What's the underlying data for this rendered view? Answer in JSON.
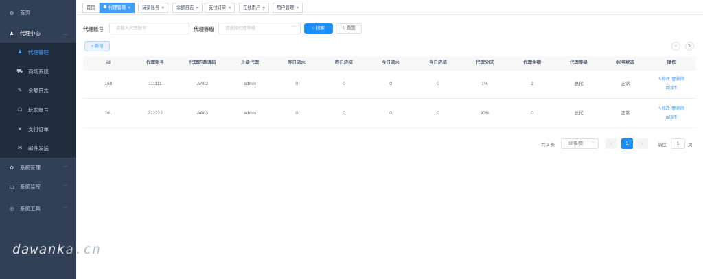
{
  "sidebar": {
    "items": [
      {
        "label": "首页",
        "icon": "dashboard-icon"
      },
      {
        "label": "代理中心",
        "icon": "user-group-icon"
      },
      {
        "label": "系统管理",
        "icon": "gear-icon"
      },
      {
        "label": "系统监控",
        "icon": "monitor-icon"
      },
      {
        "label": "系统工具",
        "icon": "toolbox-icon"
      }
    ],
    "sub_items": [
      {
        "label": "代理管理",
        "icon": "user-icon"
      },
      {
        "label": "商场系统",
        "icon": "cart-icon"
      },
      {
        "label": "余额日志",
        "icon": "log-icon"
      },
      {
        "label": "玩家账号",
        "icon": "gamepad-icon"
      },
      {
        "label": "支付订单",
        "icon": "yen-icon"
      },
      {
        "label": "邮件发送",
        "icon": "mail-icon"
      }
    ],
    "active_color": "#409eff",
    "bg_color": "#304156"
  },
  "watermark": {
    "main": "dawank",
    "suffix": "a.cn"
  },
  "tags": [
    {
      "label": "首页"
    },
    {
      "label": "代理管理"
    },
    {
      "label": "玩家账号"
    },
    {
      "label": "余额日志"
    },
    {
      "label": "支付订单"
    },
    {
      "label": "在线用户"
    },
    {
      "label": "用户管理"
    }
  ],
  "search": {
    "account_label": "代理账号",
    "account_placeholder": "请输入代理账号",
    "level_label": "代理等级",
    "level_placeholder": "请选择代理等级",
    "search_button": "搜索",
    "reset_button": "重置"
  },
  "toolbar": {
    "add_button": "新增"
  },
  "table": {
    "headers": [
      "id",
      "代理账号",
      "代理的邀请码",
      "上级代理",
      "昨日流水",
      "昨日应结",
      "今日流水",
      "今日应结",
      "代理分成",
      "代理余额",
      "代理等级",
      "帐号状态",
      "操作"
    ],
    "rows": [
      {
        "cells": [
          "160",
          "111111",
          "AA02",
          "admin",
          "0",
          "0",
          "0",
          "0",
          "1%",
          "2",
          "总代",
          "正常"
        ],
        "edit": "修改",
        "delete": "删除",
        "add_coin": "加币"
      },
      {
        "cells": [
          "161",
          "222222",
          "AA03",
          "admin",
          "0",
          "0",
          "0",
          "0",
          "90%",
          "0",
          "总代",
          "正常"
        ],
        "edit": "修改",
        "delete": "删除",
        "add_coin": "加币"
      }
    ]
  },
  "pagination": {
    "total": "共 2 条",
    "page_size": "10条/页",
    "current_page": "1",
    "goto_label": "前往",
    "goto_value": "1",
    "page_suffix": "页"
  }
}
